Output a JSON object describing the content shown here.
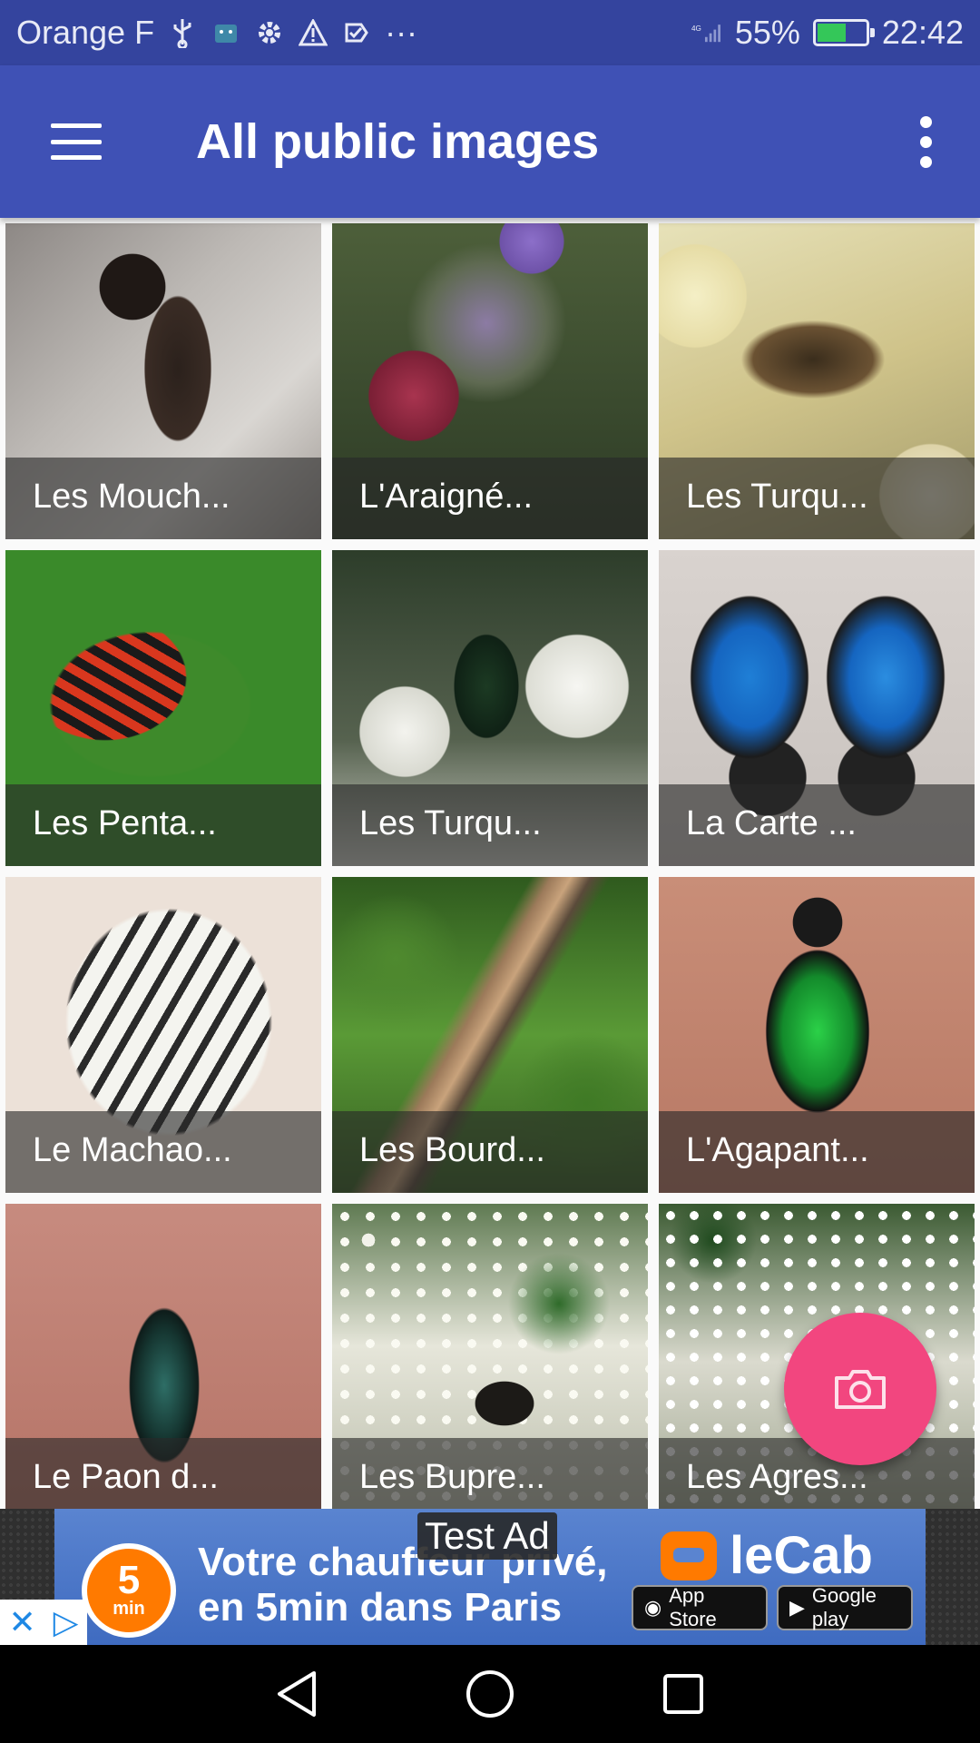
{
  "status_bar": {
    "carrier": "Orange F",
    "notification_icons": [
      "usb-icon",
      "android-icon",
      "gear-icon",
      "warning-icon",
      "checkmark-icon"
    ],
    "more": "···",
    "network": "4G",
    "battery": "55%",
    "battery_level": 0.55,
    "time": "22:42"
  },
  "app_bar": {
    "title": "All public images"
  },
  "grid": {
    "tiles": [
      {
        "label": "Les Mouch..."
      },
      {
        "label": "L'Araigné..."
      },
      {
        "label": "Les Turqu..."
      },
      {
        "label": "Les Penta..."
      },
      {
        "label": "Les Turqu..."
      },
      {
        "label": "La Carte ..."
      },
      {
        "label": "Le Machao..."
      },
      {
        "label": "Les Bourd..."
      },
      {
        "label": "L'Agapant..."
      },
      {
        "label": "Le Paon d..."
      },
      {
        "label": "Les Bupre..."
      },
      {
        "label": "Les Agres..."
      }
    ]
  },
  "fab": {
    "icon": "camera-icon"
  },
  "ad": {
    "test_label": "Test Ad",
    "timer_number": "5",
    "timer_unit": "min",
    "headline_line1": "Votre chauffeur privé,",
    "headline_line2": "en 5min dans Paris",
    "brand": "leCab",
    "app_store": "App Store",
    "google_play": "Google play"
  },
  "colors": {
    "status_bar": "#34449e",
    "app_bar": "#3f51b5",
    "fab": "#f2467f"
  }
}
